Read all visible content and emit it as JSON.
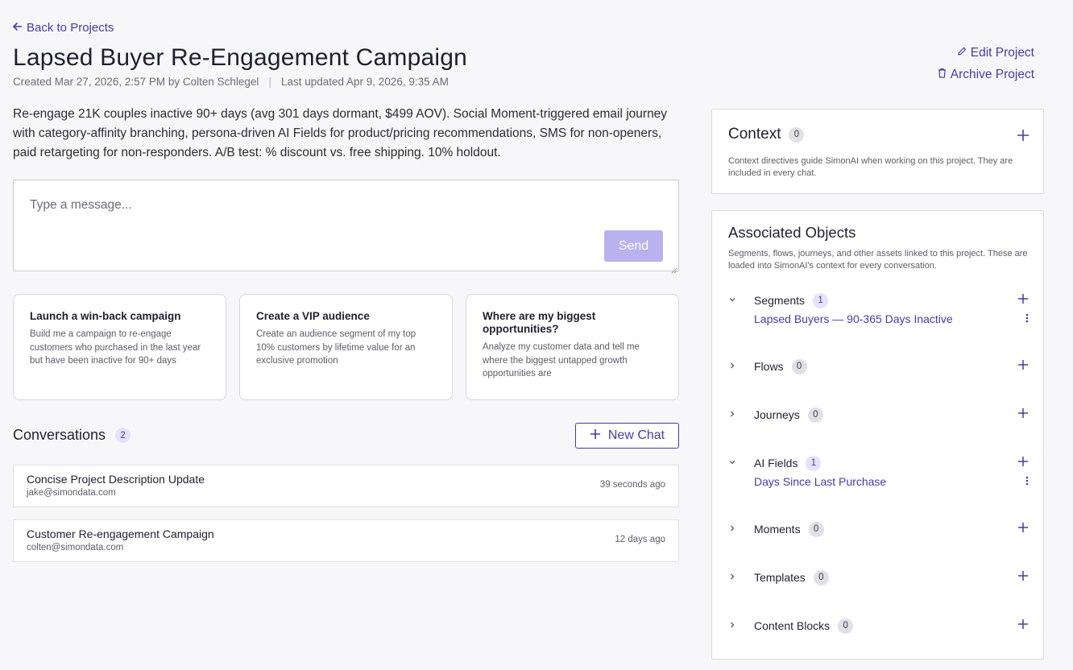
{
  "nav": {
    "back_label": "Back to Projects"
  },
  "project": {
    "title": "Lapsed Buyer Re-Engagement Campaign",
    "created": "Created Mar 27, 2026, 2:57 PM by Colten Schlegel",
    "separator": "|",
    "updated": "Last updated Apr 9, 2026, 9:35 AM",
    "description": "Re-engage 21K couples inactive 90+ days (avg 301 days dormant, $499 AOV). Social Moment-triggered email journey with category-affinity branching, persona-driven AI Fields for product/pricing recommendations, SMS for non-openers, paid retargeting for non-responders. A/B test: % discount vs. free shipping. 10% holdout."
  },
  "actions": {
    "edit_label": "Edit Project",
    "archive_label": "Archive Project"
  },
  "composer": {
    "placeholder": "Type a message...",
    "send_label": "Send"
  },
  "suggestions": [
    {
      "title": "Launch a win-back campaign",
      "body": "Build me a campaign to re-engage customers who purchased in the last year but have been inactive for 90+ days"
    },
    {
      "title": "Create a VIP audience",
      "body": "Create an audience segment of my top 10% customers by lifetime value for an exclusive promotion"
    },
    {
      "title": "Where are my biggest opportunities?",
      "body": "Analyze my customer data and tell me where the biggest untapped growth opportunities are"
    }
  ],
  "conversations": {
    "heading": "Conversations",
    "count": "2",
    "new_chat_label": "New Chat",
    "items": [
      {
        "title": "Concise Project Description Update",
        "email": "jake@simondata.com",
        "time": "39 seconds ago"
      },
      {
        "title": "Customer Re-engagement Campaign",
        "email": "colten@simondata.com",
        "time": "12 days ago"
      }
    ]
  },
  "context": {
    "heading": "Context",
    "count": "0",
    "description": "Context directives guide SimonAI when working on this project. They are included in every chat."
  },
  "associated": {
    "heading": "Associated Objects",
    "description": "Segments, flows, journeys, and other assets linked to this project. These are loaded into SimonAI's context for every conversation.",
    "sections": [
      {
        "label": "Segments",
        "count": "1",
        "expanded": true,
        "item": "Lapsed Buyers — 90-365 Days Inactive"
      },
      {
        "label": "Flows",
        "count": "0",
        "expanded": false
      },
      {
        "label": "Journeys",
        "count": "0",
        "expanded": false
      },
      {
        "label": "AI Fields",
        "count": "1",
        "expanded": true,
        "item": "Days Since Last Purchase"
      },
      {
        "label": "Moments",
        "count": "0",
        "expanded": false
      },
      {
        "label": "Templates",
        "count": "0",
        "expanded": false
      },
      {
        "label": "Content Blocks",
        "count": "0",
        "expanded": false
      }
    ]
  },
  "colors": {
    "accent": "#4a3aa8",
    "send_disabled": "#b9b2ee",
    "badge_purple_bg": "#e6e2fb"
  },
  "icons": {
    "back": "arrow-left-icon",
    "edit": "pencil-icon",
    "archive": "trash-icon",
    "plus": "plus-icon",
    "expanded": "chevron-down-icon",
    "collapsed": "chevron-right-icon",
    "more": "kebab-icon"
  }
}
